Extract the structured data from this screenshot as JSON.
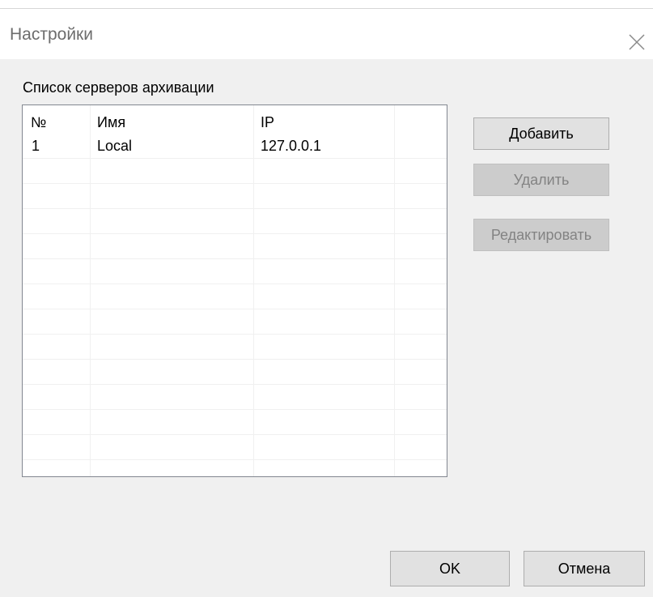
{
  "window": {
    "title": "Настройки"
  },
  "main": {
    "section_label": "Список серверов архивации",
    "list": {
      "columns": [
        "№",
        "Имя",
        "IP"
      ],
      "rows": [
        {
          "num": "1",
          "name": "Local",
          "ip": "127.0.0.1"
        }
      ]
    },
    "buttons": {
      "add": "Добавить",
      "delete": "Удалить",
      "edit": "Редактировать"
    }
  },
  "footer": {
    "ok": "OK",
    "cancel": "Отмена"
  }
}
